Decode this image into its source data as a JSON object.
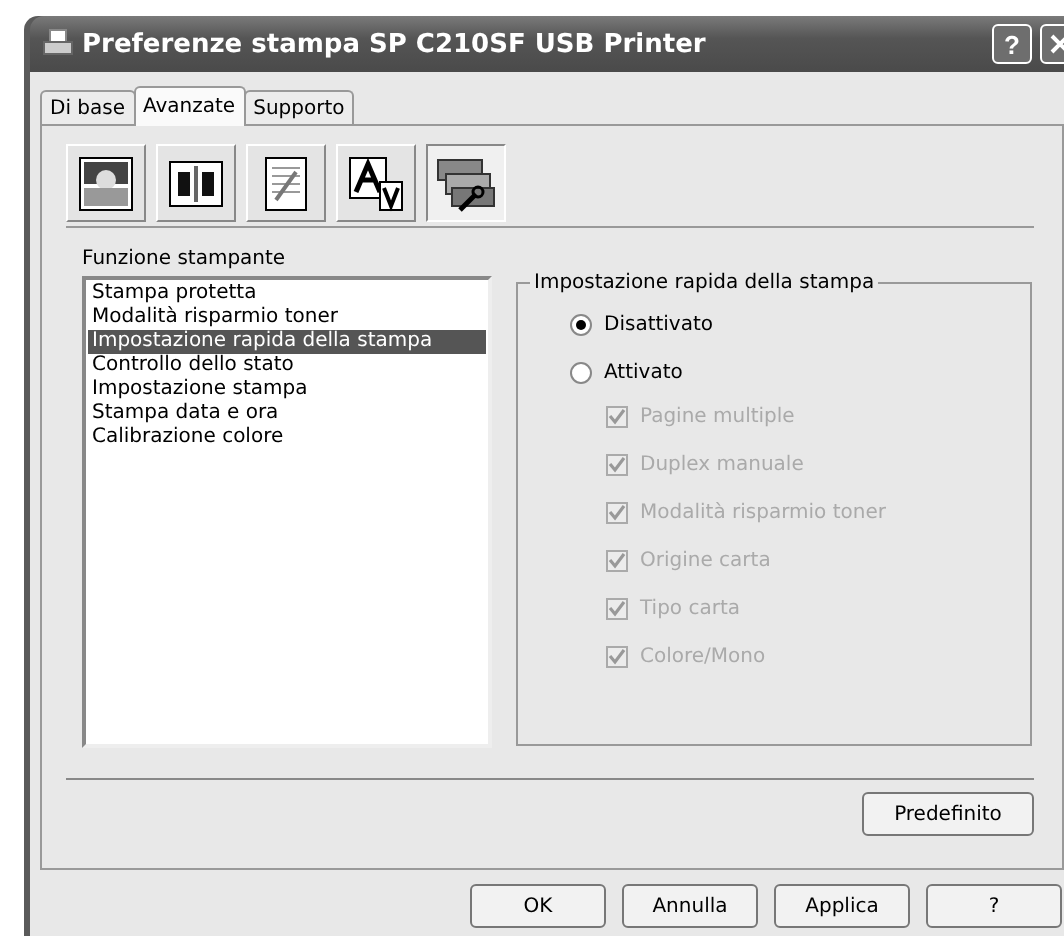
{
  "window": {
    "title": "Preferenze stampa SP C210SF USB Printer",
    "help_button": "?"
  },
  "tabs": [
    {
      "label": "Di base",
      "selected": false
    },
    {
      "label": "Avanzate",
      "selected": true
    },
    {
      "label": "Supporto",
      "selected": false
    }
  ],
  "toolbar": [
    {
      "kind": "photo",
      "selected": false
    },
    {
      "kind": "booklet",
      "selected": false
    },
    {
      "kind": "copy",
      "selected": false
    },
    {
      "kind": "font",
      "selected": false
    },
    {
      "kind": "tools",
      "selected": true
    }
  ],
  "function_list": {
    "label": "Funzione stampante",
    "items": [
      {
        "label": "Stampa protetta",
        "selected": false
      },
      {
        "label": "Modalità risparmio toner",
        "selected": false
      },
      {
        "label": "Impostazione rapida della stampa",
        "selected": true
      },
      {
        "label": "Controllo dello stato",
        "selected": false
      },
      {
        "label": "Impostazione stampa",
        "selected": false
      },
      {
        "label": "Stampa data e ora",
        "selected": false
      },
      {
        "label": "Calibrazione colore",
        "selected": false
      }
    ]
  },
  "group": {
    "title": "Impostazione rapida della stampa",
    "radios": [
      {
        "label": "Disattivato",
        "selected": true
      },
      {
        "label": "Attivato",
        "selected": false
      }
    ],
    "checkboxes": [
      {
        "label": "Pagine multiple",
        "checked": true,
        "disabled": true
      },
      {
        "label": "Duplex manuale",
        "checked": true,
        "disabled": true
      },
      {
        "label": "Modalità risparmio toner",
        "checked": true,
        "disabled": true
      },
      {
        "label": "Origine carta",
        "checked": true,
        "disabled": true
      },
      {
        "label": "Tipo carta",
        "checked": true,
        "disabled": true
      },
      {
        "label": "Colore/Mono",
        "checked": true,
        "disabled": true
      }
    ]
  },
  "default_button": "Predefinito",
  "buttons": [
    "OK",
    "Annulla",
    "Applica",
    "?"
  ]
}
